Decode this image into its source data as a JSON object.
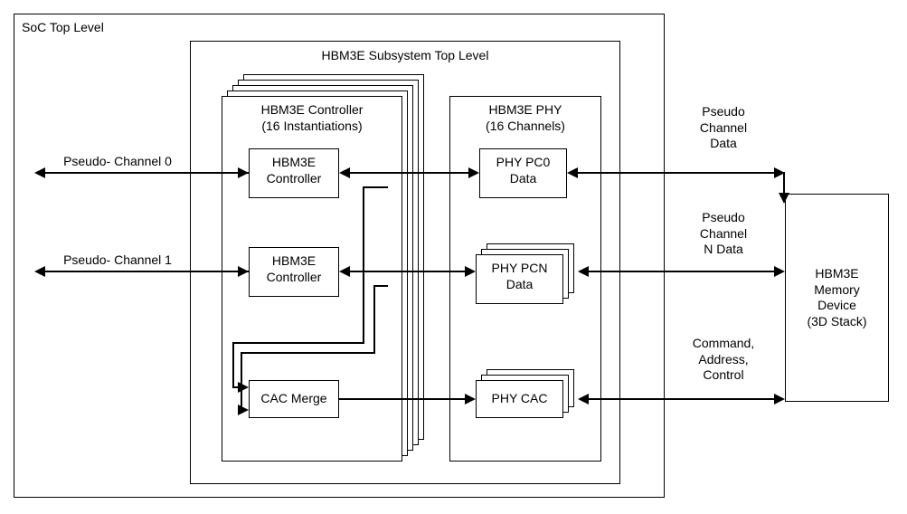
{
  "soc": {
    "title": "SoC Top Level"
  },
  "subsys": {
    "title": "HBM3E Subsystem Top Level"
  },
  "controller": {
    "title_l1": "HBM3E Controller",
    "title_l2": "(16 Instantiations)",
    "ctrl_box": "HBM3E\nController",
    "cac_merge": "CAC Merge"
  },
  "phy": {
    "title_l1": "HBM3E PHY",
    "title_l2": "(16 Channels)",
    "pc0": "PHY PC0\nData",
    "pcn": "PHY PCN\nData",
    "cac": "PHY CAC"
  },
  "bus": {
    "pc0": "Pseudo- Channel 0",
    "pc1": "Pseudo- Channel 1",
    "right_pc": "Pseudo\nChannel\nData",
    "right_pcn": "Pseudo\nChannel\nN Data",
    "right_cac": "Command,\nAddress,\nControl"
  },
  "memdev": {
    "title": "HBM3E\nMemory\nDevice\n(3D Stack)"
  }
}
